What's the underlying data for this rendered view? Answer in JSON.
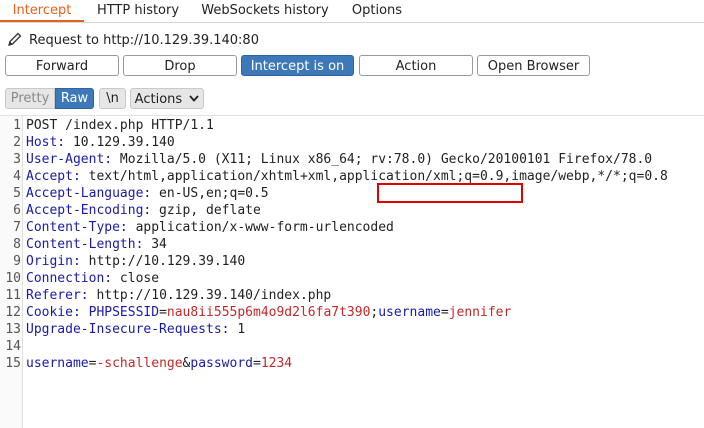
{
  "tabs": [
    {
      "label": "Intercept",
      "active": true
    },
    {
      "label": "HTTP history",
      "active": false
    },
    {
      "label": "WebSockets history",
      "active": false
    },
    {
      "label": "Options",
      "active": false
    }
  ],
  "request": {
    "label": "Request to http://10.129.39.140:80",
    "icon": "pencil-icon"
  },
  "buttons": {
    "forward": "Forward",
    "drop": "Drop",
    "intercept": "Intercept is on",
    "action": "Action",
    "open_browser": "Open Browser"
  },
  "view_toggle": {
    "pretty": "Pretty",
    "raw": "Raw",
    "newline": "\\n",
    "actions": "Actions"
  },
  "lines": [
    {
      "n": "1",
      "parts": [
        {
          "t": "POST /index.php HTTP/1.1",
          "c": "v"
        }
      ]
    },
    {
      "n": "2",
      "parts": [
        {
          "t": "Host:",
          "c": "k"
        },
        {
          "t": " 10.129.39.140",
          "c": "v"
        }
      ]
    },
    {
      "n": "3",
      "parts": [
        {
          "t": "User-Agent:",
          "c": "k"
        },
        {
          "t": " Mozilla/5.0 (X11; Linux x86_64; rv:78.0) Gecko/20100101 Firefox/78.0",
          "c": "v"
        }
      ]
    },
    {
      "n": "4",
      "parts": [
        {
          "t": "Accept:",
          "c": "k"
        },
        {
          "t": " text/html,application/xhtml+xml,application/xml;q=0.9,image/webp,*/*;q=0.8",
          "c": "v"
        }
      ]
    },
    {
      "n": "5",
      "parts": [
        {
          "t": "Accept-Language:",
          "c": "k"
        },
        {
          "t": " en-US,en;q=0.5",
          "c": "v"
        }
      ]
    },
    {
      "n": "6",
      "parts": [
        {
          "t": "Accept-Encoding:",
          "c": "k"
        },
        {
          "t": " gzip, deflate",
          "c": "v"
        }
      ]
    },
    {
      "n": "7",
      "parts": [
        {
          "t": "Content-Type:",
          "c": "k"
        },
        {
          "t": " application/x-www-form-urlencoded",
          "c": "v"
        }
      ]
    },
    {
      "n": "8",
      "parts": [
        {
          "t": "Content-Length:",
          "c": "k"
        },
        {
          "t": " 34",
          "c": "v"
        }
      ]
    },
    {
      "n": "9",
      "parts": [
        {
          "t": "Origin:",
          "c": "k"
        },
        {
          "t": " http://10.129.39.140",
          "c": "v"
        }
      ]
    },
    {
      "n": "10",
      "parts": [
        {
          "t": "Connection:",
          "c": "k"
        },
        {
          "t": " close",
          "c": "v"
        }
      ]
    },
    {
      "n": "11",
      "parts": [
        {
          "t": "Referer:",
          "c": "k"
        },
        {
          "t": " http://10.129.39.140/index.php",
          "c": "v"
        }
      ]
    },
    {
      "n": "12",
      "parts": [
        {
          "t": "Cookie:",
          "c": "k"
        },
        {
          "t": " ",
          "c": "v"
        },
        {
          "t": "PHPSESSID",
          "c": "k"
        },
        {
          "t": "=",
          "c": "v"
        },
        {
          "t": "nau8ii555p6m4o9d2l6fa7t390",
          "c": "pv"
        },
        {
          "t": ";",
          "c": "v"
        },
        {
          "t": "username",
          "c": "k"
        },
        {
          "t": "=",
          "c": "v"
        },
        {
          "t": "jennifer",
          "c": "pv"
        }
      ]
    },
    {
      "n": "13",
      "parts": [
        {
          "t": "Upgrade-Insecure-Requests:",
          "c": "k"
        },
        {
          "t": " 1",
          "c": "v"
        }
      ]
    },
    {
      "n": "14",
      "parts": []
    },
    {
      "n": "15",
      "parts": [
        {
          "t": "username",
          "c": "k"
        },
        {
          "t": "=",
          "c": "v"
        },
        {
          "t": "-schallenge",
          "c": "pv"
        },
        {
          "t": "&",
          "c": "v"
        },
        {
          "t": "password",
          "c": "k"
        },
        {
          "t": "=",
          "c": "v"
        },
        {
          "t": "1234",
          "c": "pv"
        }
      ]
    }
  ]
}
